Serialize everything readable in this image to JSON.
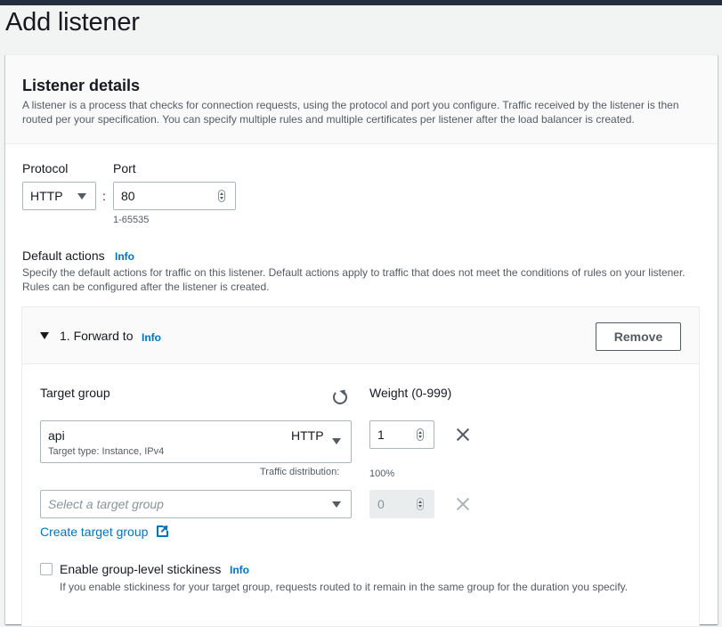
{
  "page": {
    "title": "Add listener"
  },
  "listener_details": {
    "title": "Listener details",
    "description": "A listener is a process that checks for connection requests, using the protocol and port you configure. Traffic received by the listener is then routed per your specification. You can specify multiple rules and multiple certificates per listener after the load balancer is created."
  },
  "protocol": {
    "label": "Protocol",
    "value": "HTTP"
  },
  "port": {
    "label": "Port",
    "value": "80",
    "hint": "1-65535"
  },
  "default_actions": {
    "label": "Default actions",
    "info": "Info",
    "description": "Specify the default actions for traffic on this listener. Default actions apply to traffic that does not meet the conditions of rules on your listener. Rules can be configured after the listener is created."
  },
  "forward": {
    "title": "1. Forward to",
    "info": "Info",
    "remove_label": "Remove",
    "target_group_label": "Target group",
    "weight_label": "Weight (0-999)",
    "target_groups": [
      {
        "name": "api",
        "protocol": "HTTP",
        "subtitle": "Target type: Instance, IPv4",
        "weight": "1"
      }
    ],
    "new_target_placeholder": "Select a target group",
    "new_target_weight": "0",
    "traffic_distribution_label": "Traffic distribution:",
    "traffic_distribution_value": "100%",
    "create_target_group_link": "Create target group",
    "stickiness_label": "Enable group-level stickiness",
    "stickiness_info": "Info",
    "stickiness_description": "If you enable stickiness for your target group, requests routed to it remain in the same group for the duration you specify."
  }
}
